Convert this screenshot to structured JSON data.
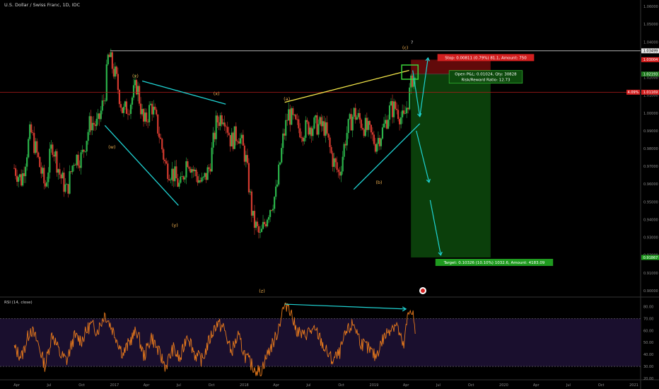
{
  "header": {
    "symbol_title": "U.S. Dollar / Swiss Franc, 1D, IDC"
  },
  "rsi_panel": {
    "title": "RSI (14, close)",
    "ticks": [
      "80.00",
      "70.00",
      "60.00",
      "50.00",
      "40.00",
      "30.00",
      "20.00"
    ]
  },
  "chart_data": [
    {
      "type": "candlestick",
      "title": "U.S. Dollar / Swiss Franc, 1D, IDC",
      "x_ticks": [
        "Apr",
        "Jul",
        "Oct",
        "2017",
        "Apr",
        "Jul",
        "Oct",
        "2018",
        "Apr",
        "Jul",
        "Oct",
        "2019",
        "Apr",
        "Jul",
        "Oct",
        "2020",
        "Apr",
        "Jul",
        "Oct",
        "2021"
      ],
      "y_ticks": [
        "0.90000",
        "0.91000",
        "0.92000",
        "0.93000",
        "0.94000",
        "0.95000",
        "0.96000",
        "0.97000",
        "0.98000",
        "0.99000",
        "1.00000",
        "1.01000",
        "1.02000",
        "1.03000",
        "1.04000",
        "1.05000",
        "1.06000"
      ],
      "ylim": [
        0.898,
        1.062
      ],
      "price_labels": [
        {
          "text": "1.03499",
          "value": 1.035,
          "color": "#e6e6e6",
          "text_color": "#000000"
        },
        {
          "text": "1.03004",
          "value": 1.03,
          "color": "#d32020",
          "text_color": "#ffffff"
        },
        {
          "text": "1.02193",
          "value": 1.0219,
          "color": "#1f7a1f",
          "text_color": "#ffffff"
        },
        {
          "text": "1.01169",
          "value": 1.0117,
          "color": "#d32020",
          "text_color": "#ffffff"
        },
        {
          "text": "0.91867",
          "value": 0.9187,
          "color": "#1f9a1f",
          "text_color": "#ffffff"
        }
      ],
      "left_price_tag": {
        "text": "4.09%",
        "value": 1.0117
      },
      "wave_labels": [
        {
          "text": "(x)",
          "x_date": "2017-03-01",
          "y": 1.02
        },
        {
          "text": "(w)",
          "x_date": "2016-12-25",
          "y": 0.98
        },
        {
          "text": "(y)",
          "x_date": "2017-06-20",
          "y": 0.936
        },
        {
          "text": "(x)",
          "x_date": "2017-10-15",
          "y": 1.01
        },
        {
          "text": "(z)",
          "x_date": "2018-02-20",
          "y": 0.899
        },
        {
          "text": "(a)",
          "x_date": "2018-05-01",
          "y": 1.007
        },
        {
          "text": "(b)",
          "x_date": "2019-01-15",
          "y": 0.96
        },
        {
          "text": "(c)",
          "x_date": "2019-03-30",
          "y": 1.036
        },
        {
          "text": "?",
          "x_date": "2019-04-18",
          "y": 1.039
        }
      ],
      "trendlines": [
        {
          "color": "#1fd3d3",
          "points": [
            [
              "2016-12-05",
              0.993
            ],
            [
              "2017-06-30",
              0.948
            ]
          ]
        },
        {
          "color": "#1fd3d3",
          "points": [
            [
              "2017-03-20",
              1.018
            ],
            [
              "2017-11-10",
              1.005
            ]
          ]
        },
        {
          "color": "#f5e84a",
          "points": [
            [
              "2018-04-25",
              1.006
            ],
            [
              "2019-04-10",
              1.024
            ]
          ]
        },
        {
          "color": "#1fd3d3",
          "points": [
            [
              "2018-11-05",
              0.957
            ],
            [
              "2019-05-10",
              0.994
            ]
          ]
        }
      ],
      "projection_path": {
        "color": "#1fd3d3",
        "points": [
          [
            "2019-04-20",
            1.024
          ],
          [
            "2019-05-10",
            0.998
          ],
          [
            "2019-06-02",
            1.031
          ]
        ],
        "second": [
          [
            "2019-04-30",
            0.99
          ],
          [
            "2019-06-05",
            0.961
          ]
        ],
        "third": [
          [
            "2019-06-08",
            0.951
          ],
          [
            "2019-07-08",
            0.92
          ]
        ]
      },
      "position": {
        "entry": 1.0219,
        "stop": 1.03,
        "target": 0.9187,
        "start_date": "2019-04-15",
        "end_date": "2019-11-25",
        "stop_label": "Stop: 0.00811 (0.79%) 81.1, Amount: 750",
        "open_label_line1": "Open P&L: 0.01024, Qty: 30828",
        "open_label_line2": "Risk/Reward Ratio: 12.73",
        "target_label": "Target: 0.10326 (10.10%) 1032.6, Amount: 4183.09"
      },
      "highlight_box": {
        "start_date": "2019-03-20",
        "end_date": "2019-05-05",
        "high": 1.027,
        "low": 1.019
      },
      "resistance_line": {
        "value": 1.035,
        "start_date": "2016-12-20"
      },
      "current_price_line": {
        "value": 1.0117
      },
      "closes": [
        [
          "2016-03-25",
          0.969
        ],
        [
          "2016-04-15",
          0.962
        ],
        [
          "2016-05-10",
          0.99
        ],
        [
          "2016-05-30",
          0.975
        ],
        [
          "2016-06-20",
          0.958
        ],
        [
          "2016-07-10",
          0.983
        ],
        [
          "2016-08-01",
          0.965
        ],
        [
          "2016-08-20",
          0.956
        ],
        [
          "2016-09-10",
          0.975
        ],
        [
          "2016-10-01",
          0.975
        ],
        [
          "2016-10-25",
          0.995
        ],
        [
          "2016-11-15",
          0.993
        ],
        [
          "2016-12-05",
          1.01
        ],
        [
          "2016-12-15",
          1.033
        ],
        [
          "2017-01-05",
          1.02
        ],
        [
          "2017-01-25",
          1.0
        ],
        [
          "2017-02-15",
          1.006
        ],
        [
          "2017-03-05",
          1.016
        ],
        [
          "2017-03-25",
          0.993
        ],
        [
          "2017-04-15",
          1.005
        ],
        [
          "2017-05-05",
          0.99
        ],
        [
          "2017-05-25",
          0.97
        ],
        [
          "2017-06-15",
          0.966
        ],
        [
          "2017-07-05",
          0.958
        ],
        [
          "2017-07-25",
          0.975
        ],
        [
          "2017-08-15",
          0.966
        ],
        [
          "2017-09-05",
          0.96
        ],
        [
          "2017-09-25",
          0.969
        ],
        [
          "2017-10-15",
          0.995
        ],
        [
          "2017-11-05",
          1.0
        ],
        [
          "2017-11-25",
          0.984
        ],
        [
          "2017-12-15",
          0.989
        ],
        [
          "2018-01-05",
          0.975
        ],
        [
          "2018-01-25",
          0.94
        ],
        [
          "2018-02-15",
          0.93
        ],
        [
          "2018-03-10",
          0.945
        ],
        [
          "2018-04-01",
          0.955
        ],
        [
          "2018-04-20",
          0.985
        ],
        [
          "2018-05-05",
          1.0
        ],
        [
          "2018-05-25",
          0.993
        ],
        [
          "2018-06-15",
          0.99
        ],
        [
          "2018-07-05",
          0.993
        ],
        [
          "2018-07-25",
          0.993
        ],
        [
          "2018-08-15",
          0.992
        ],
        [
          "2018-09-05",
          0.975
        ],
        [
          "2018-09-25",
          0.965
        ],
        [
          "2018-10-15",
          0.988
        ],
        [
          "2018-11-05",
          1.0
        ],
        [
          "2018-11-25",
          0.995
        ],
        [
          "2018-12-15",
          0.99
        ],
        [
          "2019-01-05",
          0.983
        ],
        [
          "2019-01-25",
          0.99
        ],
        [
          "2019-02-15",
          1.002
        ],
        [
          "2019-03-05",
          1.003
        ],
        [
          "2019-03-25",
          0.995
        ],
        [
          "2019-04-10",
          1.01
        ],
        [
          "2019-04-20",
          1.021
        ],
        [
          "2019-04-28",
          1.017
        ]
      ]
    },
    {
      "type": "line",
      "title": "RSI (14, close)",
      "ylim": [
        20,
        85
      ],
      "y_ticks": [
        80,
        70,
        60,
        50,
        40,
        30,
        20
      ],
      "bands": [
        70,
        30
      ],
      "divergence_line": {
        "points": [
          [
            "2018-04-25",
            82
          ],
          [
            "2019-04-01",
            78
          ]
        ]
      },
      "series": [
        {
          "values": [
            [
              "2016-03-25",
              45
            ],
            [
              "2016-04-15",
              38
            ],
            [
              "2016-05-10",
              62
            ],
            [
              "2016-05-30",
              50
            ],
            [
              "2016-06-20",
              30
            ],
            [
              "2016-07-10",
              58
            ],
            [
              "2016-08-01",
              40
            ],
            [
              "2016-08-20",
              35
            ],
            [
              "2016-09-10",
              55
            ],
            [
              "2016-10-01",
              52
            ],
            [
              "2016-10-25",
              65
            ],
            [
              "2016-11-15",
              60
            ],
            [
              "2016-12-05",
              74
            ],
            [
              "2016-12-15",
              68
            ],
            [
              "2017-01-05",
              55
            ],
            [
              "2017-01-25",
              40
            ],
            [
              "2017-02-15",
              52
            ],
            [
              "2017-03-05",
              60
            ],
            [
              "2017-03-25",
              38
            ],
            [
              "2017-04-15",
              55
            ],
            [
              "2017-05-05",
              42
            ],
            [
              "2017-05-25",
              30
            ],
            [
              "2017-06-15",
              45
            ],
            [
              "2017-07-05",
              35
            ],
            [
              "2017-07-25",
              58
            ],
            [
              "2017-08-15",
              40
            ],
            [
              "2017-09-05",
              35
            ],
            [
              "2017-09-25",
              52
            ],
            [
              "2017-10-15",
              66
            ],
            [
              "2017-11-05",
              62
            ],
            [
              "2017-11-25",
              42
            ],
            [
              "2017-12-15",
              55
            ],
            [
              "2018-01-05",
              38
            ],
            [
              "2018-01-25",
              30
            ],
            [
              "2018-02-15",
              25
            ],
            [
              "2018-03-10",
              42
            ],
            [
              "2018-04-01",
              55
            ],
            [
              "2018-04-20",
              78
            ],
            [
              "2018-05-05",
              83
            ],
            [
              "2018-05-25",
              62
            ],
            [
              "2018-06-15",
              55
            ],
            [
              "2018-07-05",
              60
            ],
            [
              "2018-07-25",
              58
            ],
            [
              "2018-08-15",
              45
            ],
            [
              "2018-09-05",
              35
            ],
            [
              "2018-09-25",
              40
            ],
            [
              "2018-10-15",
              58
            ],
            [
              "2018-11-05",
              66
            ],
            [
              "2018-11-25",
              50
            ],
            [
              "2018-12-15",
              45
            ],
            [
              "2019-01-05",
              38
            ],
            [
              "2019-01-25",
              52
            ],
            [
              "2019-02-15",
              62
            ],
            [
              "2019-03-05",
              66
            ],
            [
              "2019-03-25",
              45
            ],
            [
              "2019-04-05",
              70
            ],
            [
              "2019-04-15",
              79
            ],
            [
              "2019-04-22",
              73
            ],
            [
              "2019-04-28",
              50
            ]
          ]
        }
      ]
    }
  ]
}
